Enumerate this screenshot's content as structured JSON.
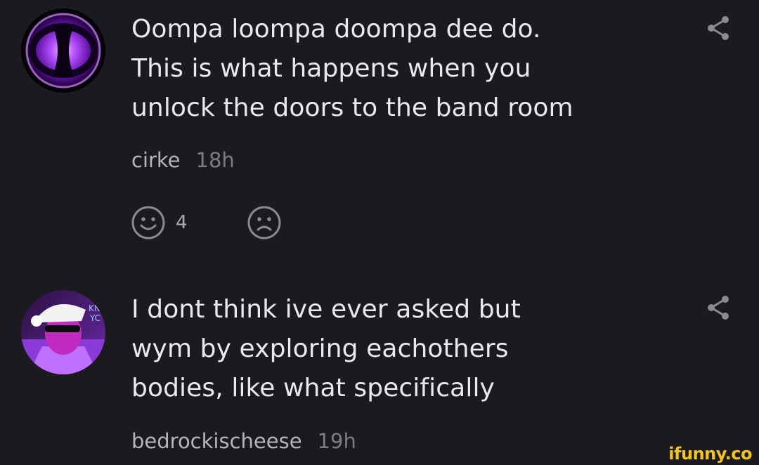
{
  "comments": [
    {
      "lines": [
        "Oompa loompa doompa dee do.",
        "This is what happens when you",
        "unlock the doors to the band room"
      ],
      "username": "cirke",
      "time": "18h",
      "reactions": {
        "smile_count": "4"
      }
    },
    {
      "lines": [
        "I dont think ive ever asked but",
        "wym by exploring eachothers",
        "bodies, like what specifically"
      ],
      "username": "bedrockischeese",
      "time": "19h"
    }
  ],
  "watermark": "ifunny.co",
  "colors": {
    "background": "#1b1b1f",
    "text": "#e9e9ee",
    "username": "#b5b5bc",
    "timestamp": "#7c7c84",
    "icon": "#8a8a92",
    "watermark": "#f5c518"
  },
  "icons": {
    "share": "share-icon",
    "smile": "smile-icon",
    "frown": "frown-icon"
  }
}
